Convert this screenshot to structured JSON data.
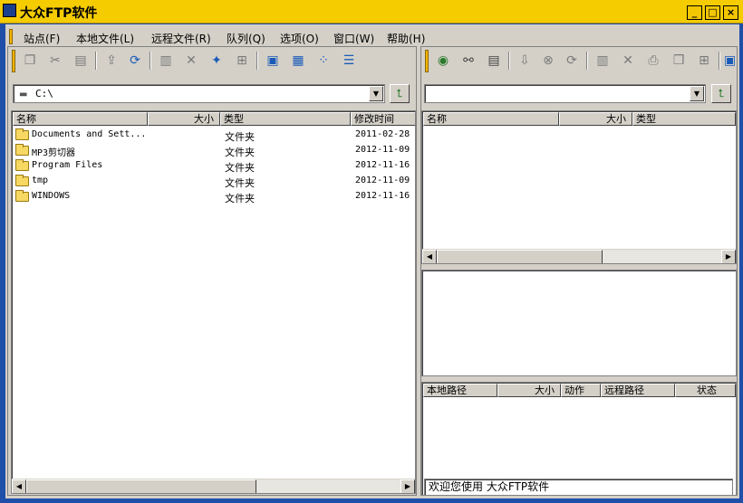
{
  "window": {
    "title": "大众FTP软件",
    "minimize": "_",
    "maximize": "□",
    "close": "×"
  },
  "menu": [
    {
      "label": "站点(F)"
    },
    {
      "label": "本地文件(L)"
    },
    {
      "label": "远程文件(R)"
    },
    {
      "label": "队列(Q)"
    },
    {
      "label": "选项(O)"
    },
    {
      "label": "窗口(W)"
    },
    {
      "label": "帮助(H)"
    }
  ],
  "left": {
    "path": "C:\\",
    "columns": [
      "名称",
      "大小",
      "类型",
      "修改时间"
    ],
    "files": [
      {
        "name": "Documents and Sett...",
        "size": "",
        "type": "文件夹",
        "modified": "2011-02-28"
      },
      {
        "name": "MP3剪切器",
        "size": "",
        "type": "文件夹",
        "modified": "2012-11-09"
      },
      {
        "name": "Program Files",
        "size": "",
        "type": "文件夹",
        "modified": "2012-11-16"
      },
      {
        "name": "tmp",
        "size": "",
        "type": "文件夹",
        "modified": "2012-11-09"
      },
      {
        "name": "WINDOWS",
        "size": "",
        "type": "文件夹",
        "modified": "2012-11-16"
      }
    ]
  },
  "right": {
    "path": "",
    "columns": [
      "名称",
      "大小",
      "类型"
    ]
  },
  "queue": {
    "columns": [
      "本地路径",
      "大小",
      "动作",
      "远程路径",
      "状态"
    ]
  },
  "status_text": "欢迎您使用 大众FTP软件",
  "icons": {
    "left_toolbar": [
      "copy-icon",
      "cut-icon",
      "paste-icon",
      "transfer-icon",
      "refresh-icon",
      "rename-icon",
      "delete-icon",
      "new-folder-icon",
      "properties-icon",
      "large-icons-view-icon",
      "small-icons-view-icon",
      "list-view-icon",
      "details-view-icon"
    ],
    "right_toolbar": [
      "connect-icon",
      "disconnect-icon",
      "site-manager-icon",
      "transfer-icon",
      "stop-icon",
      "refresh-icon",
      "rename-icon",
      "delete-icon",
      "chmod-icon",
      "new-folder-icon",
      "properties-icon",
      "view-icon"
    ]
  }
}
